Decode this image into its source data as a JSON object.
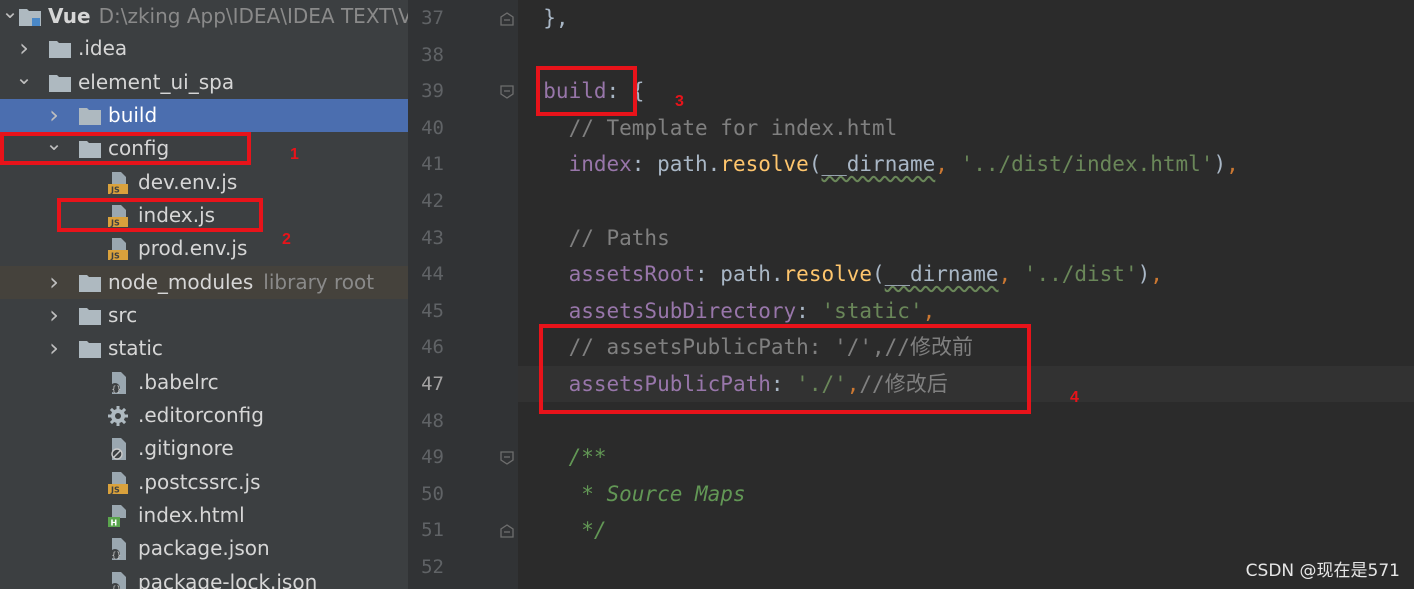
{
  "tree": {
    "rows": [
      {
        "label": "Vue",
        "path": "D:\\zking App\\IDEA\\IDEA TEXT\\V",
        "chevron": "expanded",
        "icon": "module-folder-icon",
        "indent": 0,
        "root": true
      },
      {
        "label": ".idea",
        "chevron": "collapsed",
        "icon": "folder-icon",
        "indent": 1
      },
      {
        "label": "element_ui_spa",
        "chevron": "expanded",
        "icon": "folder-icon",
        "indent": 1
      },
      {
        "label": "build",
        "chevron": "collapsed",
        "icon": "folder-icon",
        "indent": 2,
        "selected": true
      },
      {
        "label": "config",
        "chevron": "expanded",
        "icon": "folder-icon",
        "indent": 2
      },
      {
        "label": "dev.env.js",
        "icon": "js-file-icon",
        "indent": 3
      },
      {
        "label": "index.js",
        "icon": "js-file-icon",
        "indent": 3
      },
      {
        "label": "prod.env.js",
        "icon": "js-file-icon",
        "indent": 3
      },
      {
        "label": "node_modules",
        "hint": "library root",
        "chevron": "collapsed",
        "icon": "folder-icon",
        "indent": 2,
        "libroot": true
      },
      {
        "label": "src",
        "chevron": "collapsed",
        "icon": "folder-icon",
        "indent": 2
      },
      {
        "label": "static",
        "chevron": "collapsed",
        "icon": "folder-icon",
        "indent": 2
      },
      {
        "label": ".babelrc",
        "icon": "config-file-icon",
        "indent": 3
      },
      {
        "label": ".editorconfig",
        "icon": "gear-icon",
        "indent": 3
      },
      {
        "label": ".gitignore",
        "icon": "ignore-file-icon",
        "indent": 3
      },
      {
        "label": ".postcssrc.js",
        "icon": "js-file-icon",
        "indent": 3
      },
      {
        "label": "index.html",
        "icon": "html-file-icon",
        "indent": 3
      },
      {
        "label": "package.json",
        "icon": "config-file-icon",
        "indent": 3
      },
      {
        "label": "package-lock.json",
        "icon": "config-file-icon",
        "indent": 3
      }
    ]
  },
  "editor": {
    "current_line": "47",
    "lines": [
      {
        "no": "37",
        "fold": "end",
        "tokens": [
          {
            "t": "  },",
            "c": "p"
          }
        ]
      },
      {
        "no": "38",
        "tokens": []
      },
      {
        "no": "39",
        "fold": "start",
        "tokens": [
          {
            "t": "  build",
            "c": "k"
          },
          {
            "t": ": {",
            "c": "p"
          }
        ]
      },
      {
        "no": "40",
        "tokens": [
          {
            "t": "    ",
            "c": "ind"
          },
          {
            "t": "// Template for index.html",
            "c": "c"
          }
        ]
      },
      {
        "no": "41",
        "tokens": [
          {
            "t": "    ",
            "c": "ind"
          },
          {
            "t": "index",
            "c": "k"
          },
          {
            "t": ": path.",
            "c": "p"
          },
          {
            "t": "resolve",
            "c": "fn"
          },
          {
            "t": "(",
            "c": "p"
          },
          {
            "t": "__dirname",
            "c": "pu"
          },
          {
            "t": ", ",
            "c": "kw"
          },
          {
            "t": "'../dist/index.html'",
            "c": "s"
          },
          {
            "t": ")",
            "c": "p"
          },
          {
            "t": ",",
            "c": "kw"
          }
        ]
      },
      {
        "no": "42",
        "tokens": []
      },
      {
        "no": "43",
        "tokens": [
          {
            "t": "    ",
            "c": "ind"
          },
          {
            "t": "// Paths",
            "c": "c"
          }
        ]
      },
      {
        "no": "44",
        "tokens": [
          {
            "t": "    ",
            "c": "ind"
          },
          {
            "t": "assetsRoot",
            "c": "k"
          },
          {
            "t": ": path.",
            "c": "p"
          },
          {
            "t": "resolve",
            "c": "fn"
          },
          {
            "t": "(",
            "c": "p"
          },
          {
            "t": "__dirname",
            "c": "pu"
          },
          {
            "t": ", ",
            "c": "kw"
          },
          {
            "t": "'../dist'",
            "c": "s"
          },
          {
            "t": ")",
            "c": "p"
          },
          {
            "t": ",",
            "c": "kw"
          }
        ]
      },
      {
        "no": "45",
        "tokens": [
          {
            "t": "    ",
            "c": "ind"
          },
          {
            "t": "assetsSubDirectory",
            "c": "k"
          },
          {
            "t": ": ",
            "c": "p"
          },
          {
            "t": "'static'",
            "c": "s"
          },
          {
            "t": ",",
            "c": "kw"
          }
        ]
      },
      {
        "no": "46",
        "tokens": [
          {
            "t": "    ",
            "c": "ind"
          },
          {
            "t": "// assetsPublicPath: '/',//修改前",
            "c": "c"
          }
        ]
      },
      {
        "no": "47",
        "tokens": [
          {
            "t": "    ",
            "c": "ind"
          },
          {
            "t": "assetsPublicPath",
            "c": "k"
          },
          {
            "t": ": ",
            "c": "p"
          },
          {
            "t": "'./'",
            "c": "s"
          },
          {
            "t": ",",
            "c": "kw"
          },
          {
            "t": "//修改后",
            "c": "c"
          }
        ]
      },
      {
        "no": "48",
        "tokens": []
      },
      {
        "no": "49",
        "fold": "start",
        "tokens": [
          {
            "t": "    ",
            "c": "ind"
          },
          {
            "t": "/**",
            "c": "doc"
          }
        ]
      },
      {
        "no": "50",
        "tokens": [
          {
            "t": "     ",
            "c": "ind"
          },
          {
            "t": "* Source Maps",
            "c": "doc"
          }
        ]
      },
      {
        "no": "51",
        "fold": "end",
        "tokens": [
          {
            "t": "     ",
            "c": "ind"
          },
          {
            "t": "*/",
            "c": "doc"
          }
        ]
      },
      {
        "no": "52",
        "tokens": []
      }
    ]
  },
  "annotations": [
    "1",
    "2",
    "3",
    "4"
  ],
  "watermark": "CSDN @现在是571",
  "colors": {
    "highlight": "#e8131a",
    "selection": "#4b6eaf"
  }
}
